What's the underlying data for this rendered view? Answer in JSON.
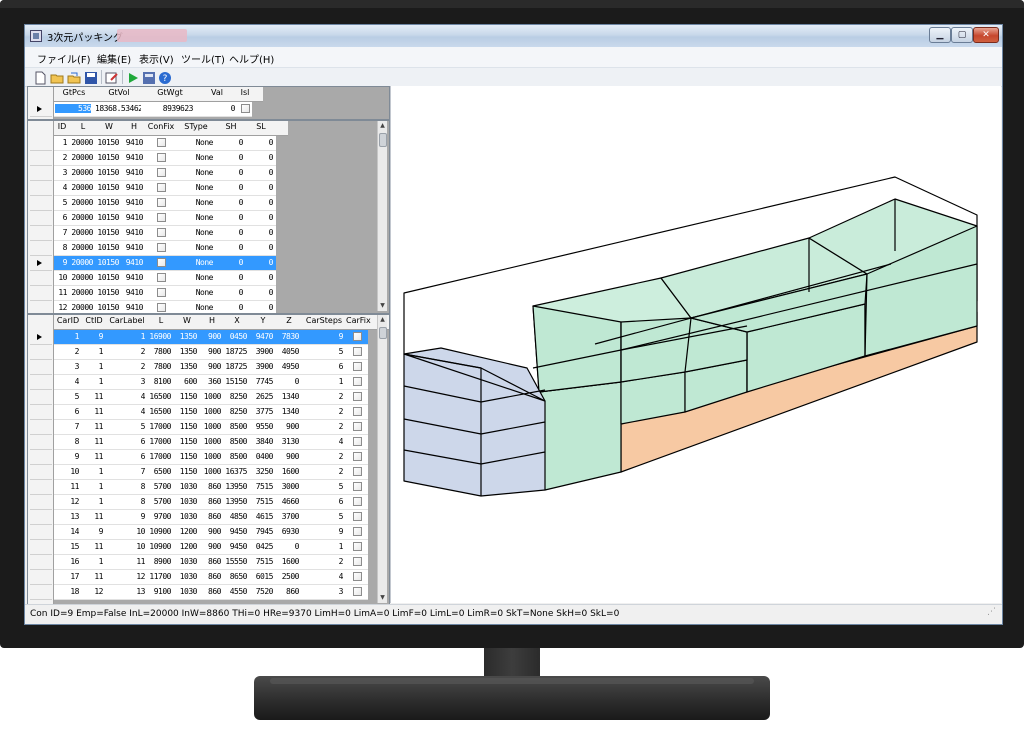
{
  "window": {
    "title": "3次元パッキング"
  },
  "menu": [
    "ファイル(F)",
    "編集(E)",
    "表示(V)",
    "ツール(T)",
    "ヘルプ(H)"
  ],
  "toolbar_icons": [
    "new-file-icon",
    "open-folder-icon",
    "open-multiple-icon",
    "save-disk-icon",
    "edit-form-icon",
    "run-play-icon",
    "save-result-icon",
    "help-question-icon"
  ],
  "summary": {
    "headers": [
      "GtPcs",
      "GtVol",
      "GtWgt",
      "Val",
      "Isl"
    ],
    "row": [
      "536",
      "18368.53462",
      "8939623",
      "0",
      ""
    ]
  },
  "containers": {
    "headers": [
      "ID",
      "L",
      "W",
      "H",
      "ConFix",
      "SType",
      "SH",
      "SL"
    ],
    "selected_index": 8,
    "rows": [
      [
        "1",
        "20000",
        "10150",
        "9410",
        "",
        "None",
        "0",
        "0"
      ],
      [
        "2",
        "20000",
        "10150",
        "9410",
        "",
        "None",
        "0",
        "0"
      ],
      [
        "3",
        "20000",
        "10150",
        "9410",
        "",
        "None",
        "0",
        "0"
      ],
      [
        "4",
        "20000",
        "10150",
        "9410",
        "",
        "None",
        "0",
        "0"
      ],
      [
        "5",
        "20000",
        "10150",
        "9410",
        "",
        "None",
        "0",
        "0"
      ],
      [
        "6",
        "20000",
        "10150",
        "9410",
        "",
        "None",
        "0",
        "0"
      ],
      [
        "7",
        "20000",
        "10150",
        "9410",
        "",
        "None",
        "0",
        "0"
      ],
      [
        "8",
        "20000",
        "10150",
        "9410",
        "",
        "None",
        "0",
        "0"
      ],
      [
        "9",
        "20000",
        "10150",
        "9410",
        "",
        "None",
        "0",
        "0"
      ],
      [
        "10",
        "20000",
        "10150",
        "9410",
        "",
        "None",
        "0",
        "0"
      ],
      [
        "11",
        "20000",
        "10150",
        "9410",
        "",
        "None",
        "0",
        "0"
      ],
      [
        "12",
        "20000",
        "10150",
        "9410",
        "",
        "None",
        "0",
        "0"
      ]
    ]
  },
  "cargo": {
    "headers": [
      "CarID",
      "CtID",
      "CarLabel",
      "L",
      "W",
      "H",
      "X",
      "Y",
      "Z",
      "CarSteps",
      "CarFix"
    ],
    "selected_index": 0,
    "rows": [
      [
        "1",
        "9",
        "1",
        "16900",
        "1350",
        "900",
        "0450",
        "9470",
        "7830",
        "9",
        ""
      ],
      [
        "2",
        "1",
        "2",
        "7800",
        "1350",
        "900",
        "18725",
        "3900",
        "4050",
        "5",
        ""
      ],
      [
        "3",
        "1",
        "2",
        "7800",
        "1350",
        "900",
        "18725",
        "3900",
        "4950",
        "6",
        ""
      ],
      [
        "4",
        "1",
        "3",
        "8100",
        "600",
        "360",
        "15150",
        "7745",
        "0",
        "1",
        ""
      ],
      [
        "5",
        "11",
        "4",
        "16500",
        "1150",
        "1000",
        "8250",
        "2625",
        "1340",
        "2",
        ""
      ],
      [
        "6",
        "11",
        "4",
        "16500",
        "1150",
        "1000",
        "8250",
        "3775",
        "1340",
        "2",
        ""
      ],
      [
        "7",
        "11",
        "5",
        "17000",
        "1150",
        "1000",
        "8500",
        "9550",
        "900",
        "2",
        ""
      ],
      [
        "8",
        "11",
        "6",
        "17000",
        "1150",
        "1000",
        "8500",
        "3840",
        "3130",
        "4",
        ""
      ],
      [
        "9",
        "11",
        "6",
        "17000",
        "1150",
        "1000",
        "8500",
        "0400",
        "900",
        "2",
        ""
      ],
      [
        "10",
        "1",
        "7",
        "6500",
        "1150",
        "1000",
        "16375",
        "3250",
        "1600",
        "2",
        ""
      ],
      [
        "11",
        "1",
        "8",
        "5700",
        "1030",
        "860",
        "13950",
        "7515",
        "3000",
        "5",
        ""
      ],
      [
        "12",
        "1",
        "8",
        "5700",
        "1030",
        "860",
        "13950",
        "7515",
        "4660",
        "6",
        ""
      ],
      [
        "13",
        "11",
        "9",
        "9700",
        "1030",
        "860",
        "4850",
        "4615",
        "3700",
        "5",
        ""
      ],
      [
        "14",
        "9",
        "10",
        "10900",
        "1200",
        "900",
        "9450",
        "7945",
        "6930",
        "9",
        ""
      ],
      [
        "15",
        "11",
        "10",
        "10900",
        "1200",
        "900",
        "9450",
        "0425",
        "0",
        "1",
        ""
      ],
      [
        "16",
        "1",
        "11",
        "8900",
        "1030",
        "860",
        "15550",
        "7515",
        "1600",
        "2",
        ""
      ],
      [
        "17",
        "11",
        "12",
        "11700",
        "1030",
        "860",
        "8650",
        "6015",
        "2500",
        "4",
        ""
      ],
      [
        "18",
        "12",
        "13",
        "9100",
        "1030",
        "860",
        "4550",
        "7520",
        "860",
        "3",
        ""
      ]
    ]
  },
  "status": "Con ID=9 Emp=False InL=20000 InW=8860 THi=0 HRe=9370 LimH=0 LimA=0 LimF=0 LimL=0 LimR=0 SkT=None SkH=0 SkL=0",
  "colors": {
    "box_green": "#bfe8d3",
    "box_orange": "#f7c9a3",
    "box_blue": "#cdd7ea",
    "selection": "#3399ff"
  }
}
